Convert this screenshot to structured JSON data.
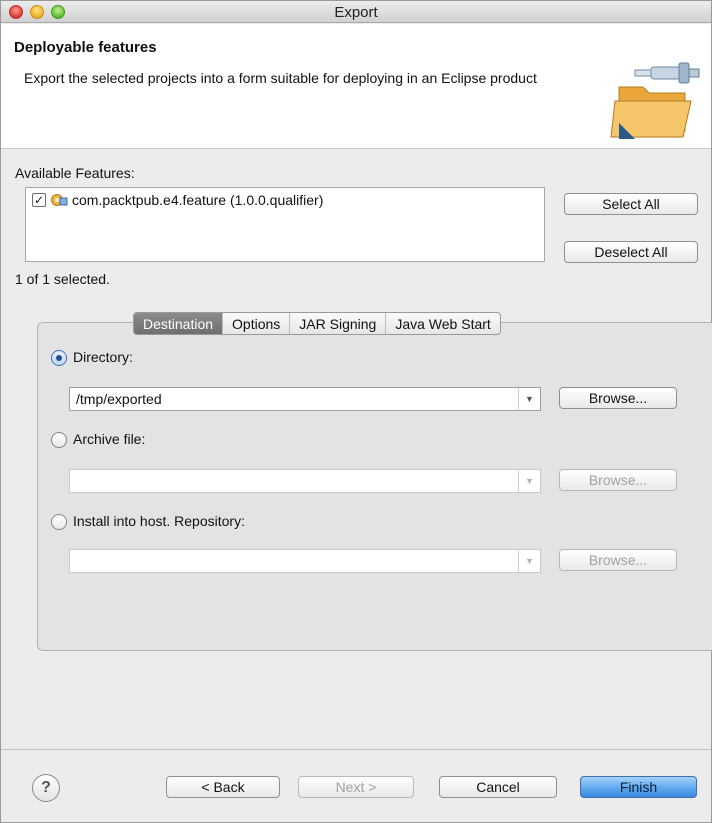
{
  "window": {
    "title": "Export"
  },
  "header": {
    "title": "Deployable features",
    "description": "Export the selected projects into a form suitable for deploying in an Eclipse product"
  },
  "features": {
    "label": "Available Features:",
    "items": [
      {
        "label": "com.packtpub.e4.feature (1.0.0.qualifier)",
        "checked": true
      }
    ],
    "select_all": "Select All",
    "deselect_all": "Deselect All",
    "status": "1 of 1 selected."
  },
  "tabs": [
    "Destination",
    "Options",
    "JAR Signing",
    "Java Web Start"
  ],
  "destination": {
    "directory_label": "Directory:",
    "directory_value": "/tmp/exported",
    "archive_label": "Archive file:",
    "archive_value": "",
    "install_label": "Install into host. Repository:",
    "install_value": "",
    "browse": "Browse..."
  },
  "footer": {
    "back": "< Back",
    "next": "Next >",
    "cancel": "Cancel",
    "finish": "Finish"
  },
  "colors": {
    "accent": "#5ea8ee",
    "tab_active": "#7a7a7a"
  }
}
